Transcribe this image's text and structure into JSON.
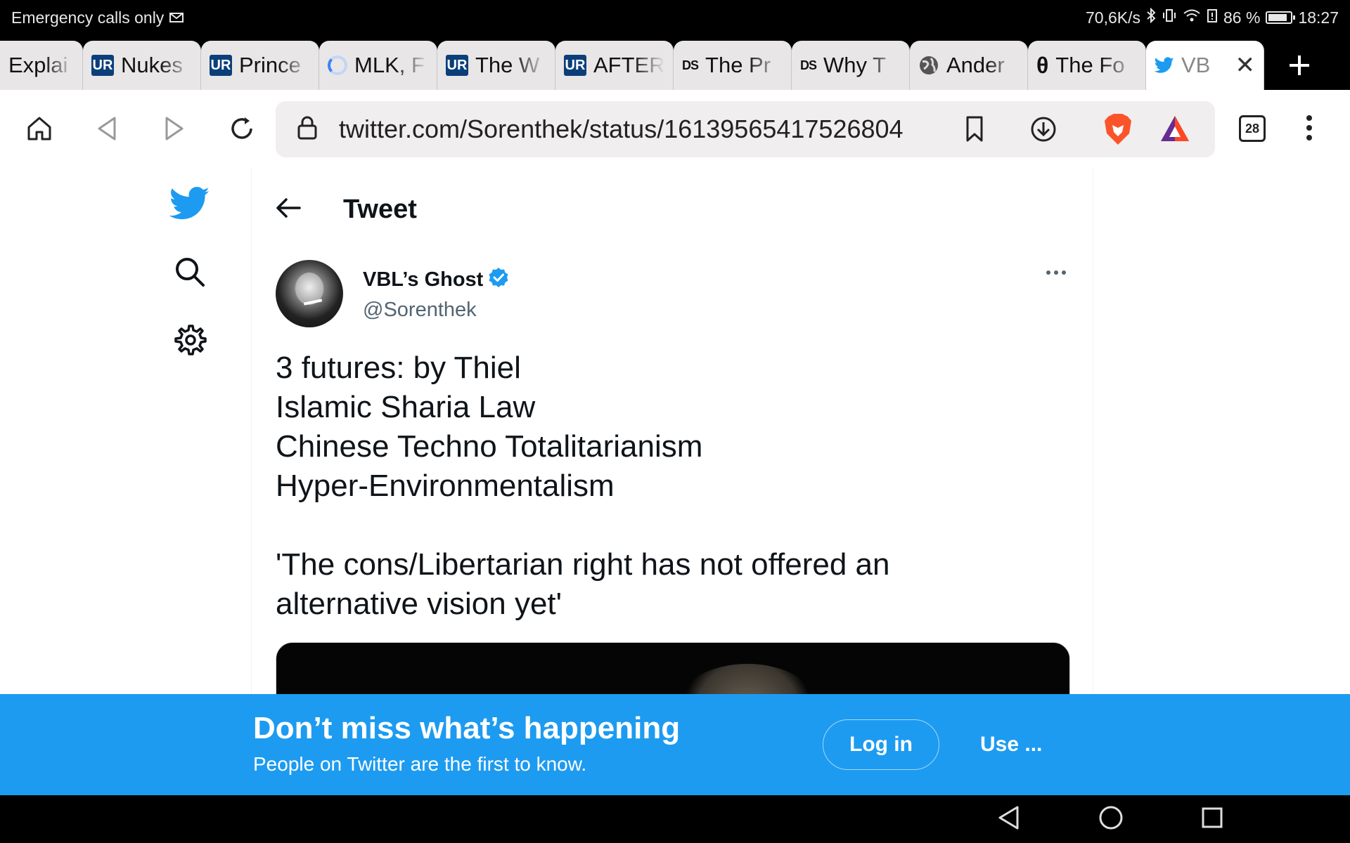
{
  "statusbar": {
    "left_text": "Emergency calls only",
    "speed": "70,6K/s",
    "battery": "86 %",
    "battery_level": 0.86,
    "time": "18:27"
  },
  "tabs": [
    {
      "label": "Explai",
      "favicon": "none"
    },
    {
      "label": "Nukes",
      "favicon": "ur-logo-icon"
    },
    {
      "label": "Prince",
      "favicon": "ur-logo-icon"
    },
    {
      "label": "MLK, F",
      "favicon": "loading-spinner-icon"
    },
    {
      "label": "The W",
      "favicon": "ur-logo-icon"
    },
    {
      "label": "AFTER",
      "favicon": "ur-logo-icon"
    },
    {
      "label": "The Pr",
      "favicon": "ds-logo-icon"
    },
    {
      "label": "Why T",
      "favicon": "ds-logo-icon"
    },
    {
      "label": "Ander",
      "favicon": "globe-icon"
    },
    {
      "label": "The Fo",
      "favicon": "theta-icon"
    },
    {
      "label": "VB",
      "favicon": "twitter-bird-icon",
      "active": true
    }
  ],
  "favicon_text": {
    "ur": "UR",
    "ds": "DS",
    "theta": "θ"
  },
  "toolbar": {
    "url": "twitter.com/Sorenthek/status/16139565417526804",
    "tab_count": "28"
  },
  "header": {
    "title": "Tweet"
  },
  "tweet": {
    "display_name": "VBL’s Ghost",
    "handle": "@Sorenthek",
    "lines": [
      "3 futures: by Thiel",
      "Islamic Sharia Law",
      "Chinese Techno Totalitarianism",
      "Hyper-Environmentalism",
      "",
      "'The cons/Libertarian right has not offered an",
      "alternative vision yet'"
    ]
  },
  "banner": {
    "headline": "Don’t miss what’s happening",
    "subline": "People on Twitter are the first to know.",
    "login_label": "Log in",
    "use_label": "Use ..."
  },
  "colors": {
    "twitter_blue": "#1d9bf0",
    "text_primary": "#0f1419",
    "text_secondary": "#536471"
  }
}
